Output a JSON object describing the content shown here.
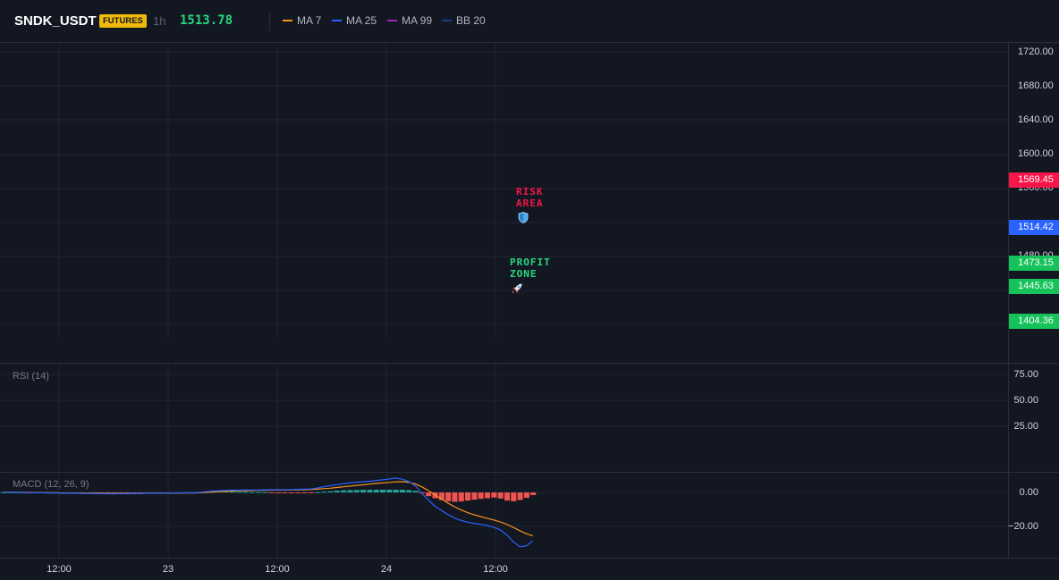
{
  "header": {
    "symbol": "SNDK_USDT",
    "market_badge": "FUTURES",
    "interval": "1h",
    "last_price": "1513.78",
    "indicators": [
      {
        "label": "MA 7",
        "color": "#f7931a"
      },
      {
        "label": "MA 25",
        "color": "#2962ff"
      },
      {
        "label": "MA 99",
        "color": "#9c27b0"
      },
      {
        "label": "BB 20",
        "color": "#1e3a8a"
      }
    ]
  },
  "price_axis": {
    "ticks": [
      "1720.00",
      "1680.00",
      "1640.00",
      "1600.00",
      "1560.00",
      "1480.00"
    ],
    "tags": [
      {
        "label": "1569.45",
        "color": "#f7154a"
      },
      {
        "label": "1514.42",
        "color": "#2962ff"
      },
      {
        "label": "1473.15",
        "color": "#16c25a"
      },
      {
        "label": "1445.63",
        "color": "#16c25a"
      },
      {
        "label": "1404.36",
        "color": "#16c25a"
      }
    ]
  },
  "annotations": {
    "risk": {
      "line1": "RISK",
      "line2": "AREA",
      "color": "#f7154a",
      "icon": "shield-icon"
    },
    "profit": {
      "line1": "PROFIT",
      "line2": "ZONE",
      "color": "#26d97f",
      "icon": "rocket-icon"
    }
  },
  "rsi": {
    "title": "RSI (14)",
    "ticks": [
      "75.00",
      "50.00",
      "25.00"
    ]
  },
  "macd": {
    "title": "MACD (12, 26, 9)",
    "ticks": [
      "0.00",
      "−20.00"
    ],
    "colors": {
      "macd_line": "#2962ff",
      "signal_line": "#f7931a",
      "hist_pos": "#26a69a",
      "hist_neg": "#ef5350"
    },
    "histogram": [
      0.1,
      0.1,
      0.1,
      0.1,
      -0.1,
      -0.1,
      -0.1,
      -0.1,
      -0.1,
      -0.1,
      -0.2,
      -0.2,
      -0.2,
      -0.2,
      -0.2,
      -0.3,
      -0.3,
      -0.3,
      -0.3,
      -0.3,
      -0.3,
      -0.3,
      -0.3,
      -0.3,
      -0.3,
      -0.4,
      -0.4,
      -0.4,
      -0.4,
      -0.3,
      0.2,
      0.4,
      0.5,
      0.6,
      0.6,
      0.4,
      0.3,
      0.3,
      0.2,
      0.2,
      0.1,
      -0.2,
      -0.3,
      -0.4,
      -0.4,
      -0.3,
      -0.2,
      -0.1,
      0.2,
      0.4,
      0.7,
      1.0,
      1.2,
      1.3,
      1.4,
      1.5,
      1.5,
      1.6,
      1.6,
      1.6,
      1.6,
      1.5,
      1.3,
      0.9,
      -0.6,
      -2.2,
      -3.5,
      -4.6,
      -5.2,
      -5.5,
      -5.3,
      -4.8,
      -4.3,
      -3.8,
      -3.4,
      -3.0,
      -3.6,
      -4.8,
      -5.2,
      -4.5,
      -3.2,
      -1.6
    ],
    "macd_line": [
      0.1,
      0.1,
      0.0,
      0.0,
      -0.1,
      -0.2,
      -0.2,
      -0.3,
      -0.3,
      -0.4,
      -0.5,
      -0.5,
      -0.6,
      -0.6,
      -0.7,
      -0.7,
      -0.8,
      -0.8,
      -0.7,
      -0.7,
      -0.6,
      -0.6,
      -0.5,
      -0.5,
      -0.4,
      -0.4,
      -0.3,
      -0.3,
      -0.2,
      -0.2,
      0.0,
      0.4,
      0.8,
      1.0,
      1.2,
      1.3,
      1.3,
      1.4,
      1.4,
      1.4,
      1.5,
      1.5,
      1.6,
      1.6,
      1.7,
      1.8,
      1.9,
      2.0,
      2.6,
      3.3,
      4.0,
      4.6,
      5.2,
      5.6,
      6.0,
      6.3,
      6.6,
      7.0,
      7.4,
      7.9,
      8.5,
      7.8,
      6.5,
      4.0,
      -0.5,
      -4.5,
      -8.0,
      -10.5,
      -13.0,
      -15.0,
      -16.5,
      -17.5,
      -18.2,
      -18.8,
      -19.5,
      -20.5,
      -22.0,
      -25.0,
      -29.0,
      -32.0,
      -31.5,
      -28.5
    ],
    "signal_line": [
      0.1,
      0.1,
      0.1,
      0.0,
      0.0,
      -0.1,
      -0.1,
      -0.2,
      -0.2,
      -0.3,
      -0.3,
      -0.4,
      -0.4,
      -0.5,
      -0.5,
      -0.5,
      -0.6,
      -0.6,
      -0.6,
      -0.6,
      -0.6,
      -0.6,
      -0.5,
      -0.5,
      -0.5,
      -0.4,
      -0.4,
      -0.4,
      -0.3,
      -0.3,
      -0.2,
      0.0,
      0.2,
      0.4,
      0.6,
      0.8,
      0.9,
      1.0,
      1.1,
      1.2,
      1.2,
      1.3,
      1.4,
      1.4,
      1.5,
      1.5,
      1.6,
      1.7,
      1.9,
      2.2,
      2.5,
      2.9,
      3.3,
      3.7,
      4.1,
      4.5,
      4.9,
      5.3,
      5.6,
      5.9,
      6.2,
      6.3,
      6.0,
      5.0,
      3.3,
      1.1,
      -1.4,
      -3.8,
      -6.2,
      -8.4,
      -10.3,
      -11.9,
      -13.1,
      -14.2,
      -15.2,
      -16.2,
      -17.3,
      -18.8,
      -20.6,
      -22.5,
      -24.3,
      -25.6
    ]
  },
  "time_axis": {
    "labels": [
      "12:00",
      "23",
      "12:00",
      "24",
      "12:00"
    ]
  }
}
